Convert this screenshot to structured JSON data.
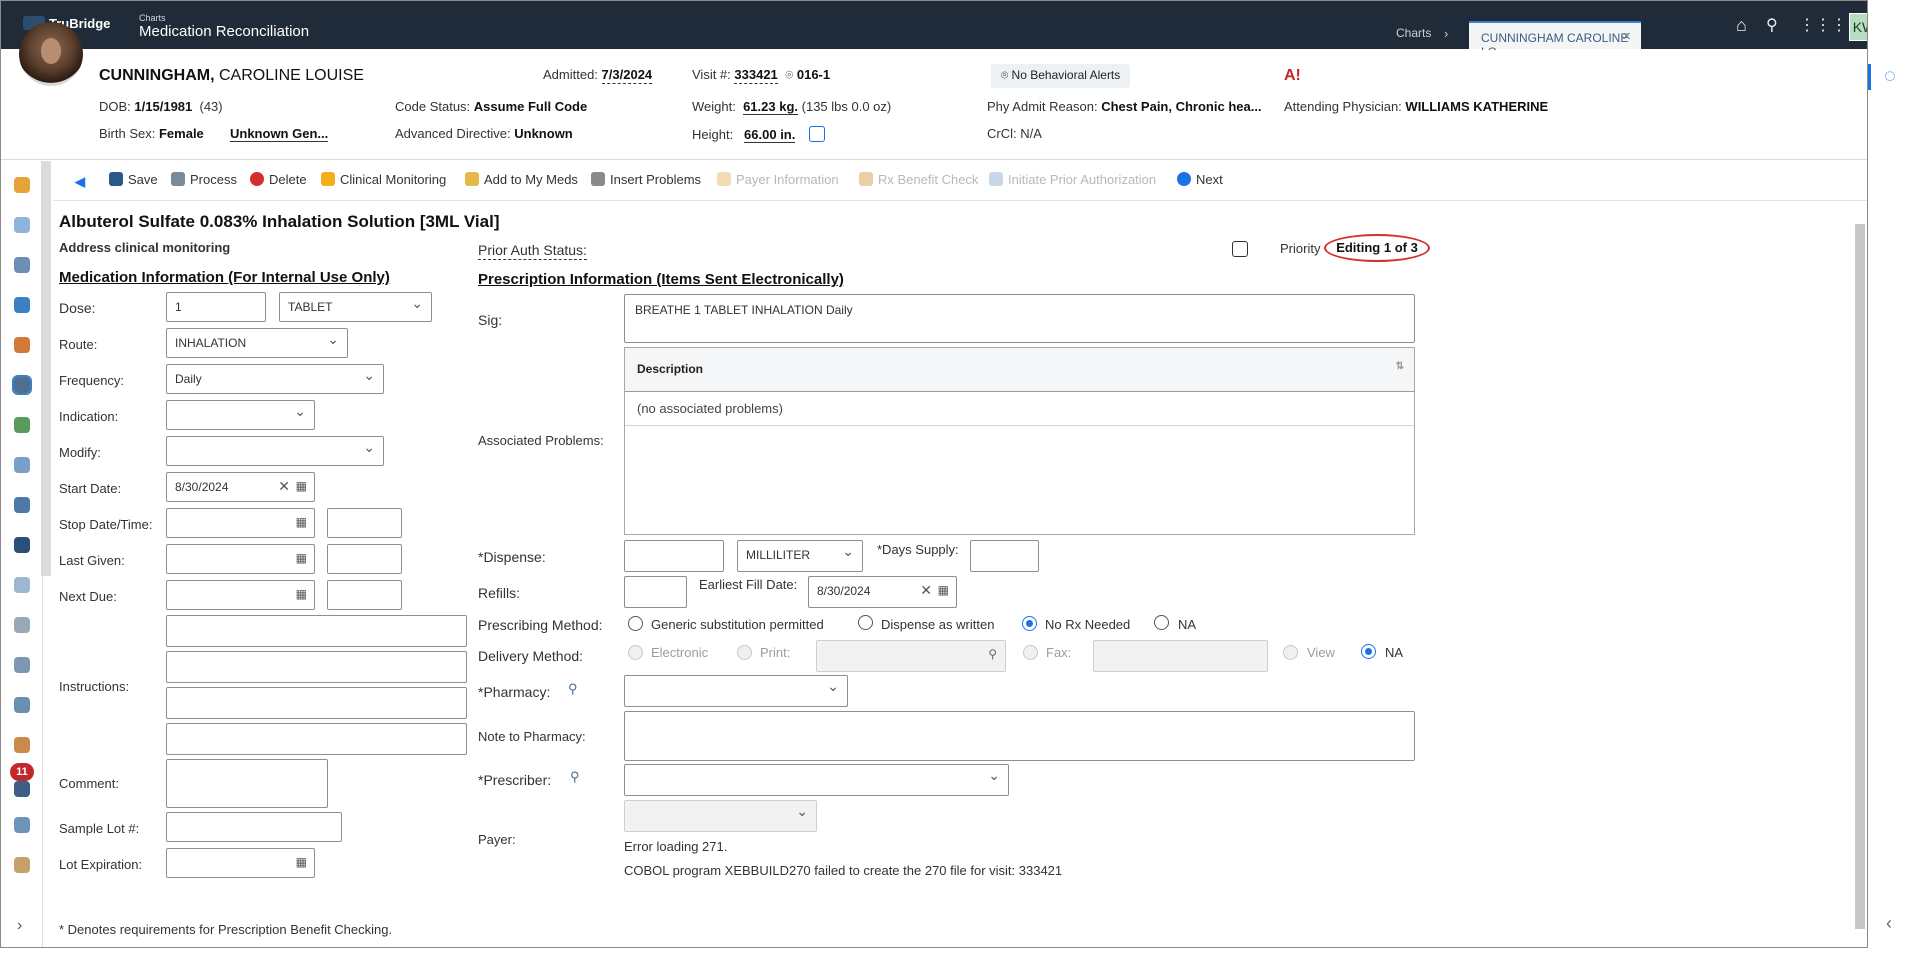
{
  "app": {
    "brand": "TruBridge",
    "context": "Charts",
    "module": "Medication Reconciliation"
  },
  "tabs": {
    "charts": "Charts",
    "active": "CUNNINGHAM CAROLINE LO",
    "close": "×"
  },
  "user": {
    "initials": "KW"
  },
  "patient": {
    "last_name": "CUNNINGHAM,",
    "first_names": " CAROLINE LOUISE",
    "dob_label": "DOB:",
    "dob": "1/15/1981",
    "age": "(43)",
    "sex_label": "Birth Sex:",
    "sex": "Female",
    "gender": "Unknown Gen...",
    "admitted_label": "Admitted:",
    "admitted": "7/3/2024",
    "code_label": "Code Status:",
    "code": "Assume Full Code",
    "adv_label": "Advanced Directive:",
    "adv": "Unknown",
    "visit_label": "Visit #:",
    "visit": "333421",
    "room": "016-1",
    "weight_label": "Weight:",
    "weight": "61.23 kg.",
    "weight_lbs": "(135 lbs 0.0 oz)",
    "height_label": "Height:",
    "height": "66.00 in.",
    "behavioral": "No Behavioral Alerts",
    "reason_label": "Phy Admit Reason:",
    "reason": "Chest Pain, Chronic hea...",
    "crcl_label": "CrCl:",
    "crcl": "N/A",
    "attending_label": "Attending Physician:",
    "attending": "WILLIAMS KATHERINE"
  },
  "toolbar": {
    "save": "Save",
    "process": "Process",
    "delete": "Delete",
    "clinical": "Clinical Monitoring",
    "add_meds": "Add to My Meds",
    "insert": "Insert Problems",
    "payer": "Payer Information",
    "rx_benefit": "Rx Benefit Check",
    "prior_auth": "Initiate Prior Authorization",
    "next": "Next"
  },
  "med": {
    "title": "Albuterol Sulfate 0.083% Inhalation Solution [3ML Vial]",
    "address": "Address clinical monitoring"
  },
  "left": {
    "section": "Medication Information (For Internal Use Only)",
    "dose_label": "Dose:",
    "dose": "1",
    "dose_unit": "TABLET",
    "route_label": "Route:",
    "route": "INHALATION",
    "freq_label": "Frequency:",
    "freq": "Daily",
    "indication_label": "Indication:",
    "modify_label": "Modify:",
    "start_label": "Start Date:",
    "start": "8/30/2024",
    "stop_label": "Stop Date/Time:",
    "last_label": "Last Given:",
    "next_label": "Next Due:",
    "instr_label": "Instructions:",
    "comment_label": "Comment:",
    "lot_label": "Sample Lot #:",
    "lotexp_label": "Lot Expiration:"
  },
  "right": {
    "prior_label": "Prior Auth Status:",
    "priority": "Priority",
    "editing": "Editing 1 of 3",
    "section": "Prescription Information (Items Sent Electronically)",
    "sig_label": "Sig:",
    "sig": "BREATHE 1 TABLET INHALATION Daily",
    "assoc_label": "Associated Problems:",
    "desc_header": "Description",
    "no_problems": "(no associated problems)",
    "dispense_label": "*Dispense:",
    "dispense_unit": "MILLILITER",
    "days_label": "*Days Supply:",
    "refills_label": "Refills:",
    "earliest_label": "Earliest Fill Date:",
    "earliest": "8/30/2024",
    "method_label": "Prescribing Method:",
    "m_generic": "Generic substitution permitted",
    "m_daw": "Dispense as written",
    "m_norx": "No Rx Needed",
    "m_na": "NA",
    "delivery_label": "Delivery Method:",
    "d_elec": "Electronic",
    "d_print": "Print:",
    "d_fax": "Fax:",
    "d_view": "View",
    "d_na": "NA",
    "pharmacy_label": "*Pharmacy:",
    "note_label": "Note to Pharmacy:",
    "prescriber_label": "*Prescriber:",
    "payer_label": "Payer:",
    "error1": "Error loading 271.",
    "error2": "COBOL program XEBBUILD270 failed to create the 270 file for visit: 333421"
  },
  "footer": "* Denotes requirements for Prescription Benefit Checking.",
  "badge": "11",
  "colors": {
    "topbar": "#1f2b38",
    "accent": "#1a73e8",
    "alert": "#c62828",
    "edit_circle": "#d32f2f"
  }
}
